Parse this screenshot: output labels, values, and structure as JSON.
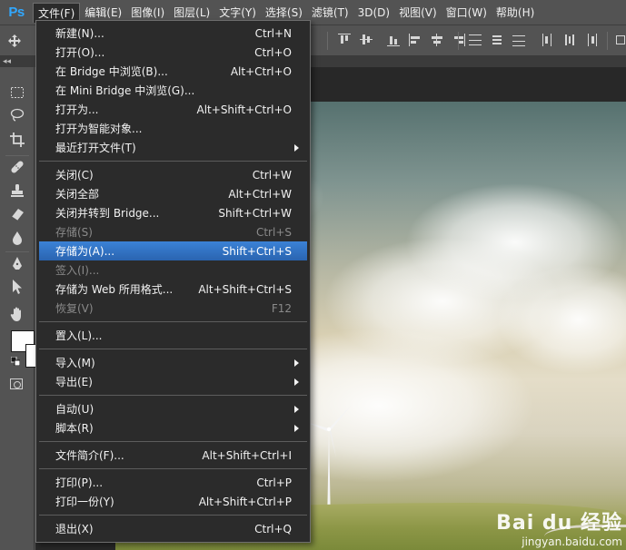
{
  "app": {
    "logo": "Ps"
  },
  "menubar": [
    "文件(F)",
    "编辑(E)",
    "图像(I)",
    "图层(L)",
    "文字(Y)",
    "选择(S)",
    "滤镜(T)",
    "3D(D)",
    "视图(V)",
    "窗口(W)",
    "帮助(H)"
  ],
  "file_menu": {
    "items": [
      {
        "label": "新建(N)...",
        "shortcut": "Ctrl+N"
      },
      {
        "label": "打开(O)...",
        "shortcut": "Ctrl+O"
      },
      {
        "label": "在 Bridge 中浏览(B)...",
        "shortcut": "Alt+Ctrl+O"
      },
      {
        "label": "在 Mini Bridge 中浏览(G)...",
        "shortcut": ""
      },
      {
        "label": "打开为...",
        "shortcut": "Alt+Shift+Ctrl+O"
      },
      {
        "label": "打开为智能对象...",
        "shortcut": ""
      },
      {
        "label": "最近打开文件(T)",
        "shortcut": ""
      },
      {
        "label": "关闭(C)",
        "shortcut": "Ctrl+W"
      },
      {
        "label": "关闭全部",
        "shortcut": "Alt+Ctrl+W"
      },
      {
        "label": "关闭并转到 Bridge...",
        "shortcut": "Shift+Ctrl+W"
      },
      {
        "label": "存储(S)",
        "shortcut": "Ctrl+S"
      },
      {
        "label": "存储为(A)...",
        "shortcut": "Shift+Ctrl+S"
      },
      {
        "label": "签入(I)...",
        "shortcut": ""
      },
      {
        "label": "存储为 Web 所用格式...",
        "shortcut": "Alt+Shift+Ctrl+S"
      },
      {
        "label": "恢复(V)",
        "shortcut": "F12"
      },
      {
        "label": "置入(L)...",
        "shortcut": ""
      },
      {
        "label": "导入(M)",
        "shortcut": ""
      },
      {
        "label": "导出(E)",
        "shortcut": ""
      },
      {
        "label": "自动(U)",
        "shortcut": ""
      },
      {
        "label": "脚本(R)",
        "shortcut": ""
      },
      {
        "label": "文件简介(F)...",
        "shortcut": "Alt+Shift+Ctrl+I"
      },
      {
        "label": "打印(P)...",
        "shortcut": "Ctrl+P"
      },
      {
        "label": "打印一份(Y)",
        "shortcut": "Alt+Shift+Ctrl+P"
      },
      {
        "label": "退出(X)",
        "shortcut": "Ctrl+Q"
      }
    ]
  },
  "watermark": {
    "logo": "Bai du 经验",
    "url": "jingyan.baidu.com"
  },
  "colors": {
    "highlight": "#2f6fbd",
    "menu_bg": "#2b2b2b",
    "chrome": "#535353",
    "logo": "#31a8ff"
  }
}
